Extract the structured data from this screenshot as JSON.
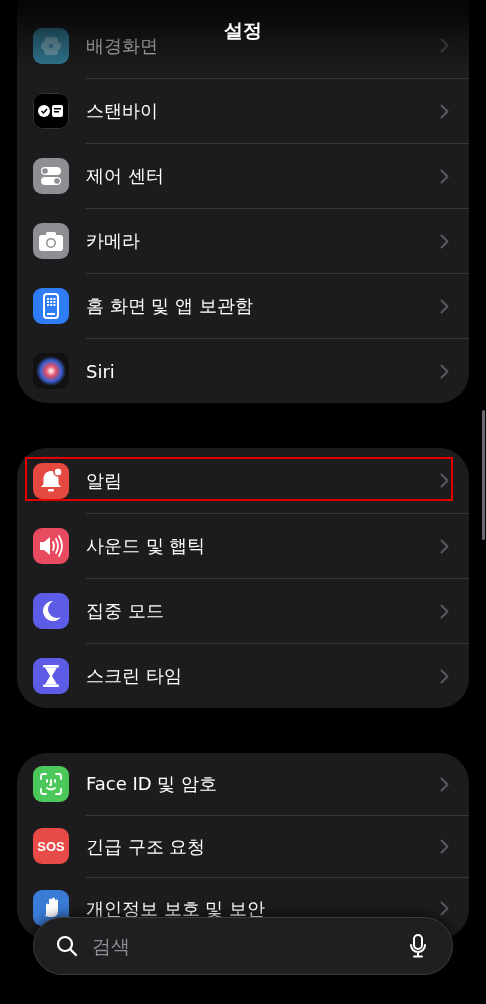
{
  "title": "설정",
  "groups": [
    {
      "items": [
        {
          "kind": "wallpaper",
          "label": "배경화면",
          "dimmed": true,
          "highlighted": false
        },
        {
          "kind": "standby",
          "label": "스탠바이",
          "dimmed": false,
          "highlighted": false
        },
        {
          "kind": "control",
          "label": "제어 센터",
          "dimmed": false,
          "highlighted": false
        },
        {
          "kind": "camera",
          "label": "카메라",
          "dimmed": false,
          "highlighted": false
        },
        {
          "kind": "home",
          "label": "홈 화면 및 앱 보관함",
          "dimmed": false,
          "highlighted": false
        },
        {
          "kind": "siri",
          "label": "Siri",
          "dimmed": false,
          "highlighted": false
        }
      ]
    },
    {
      "items": [
        {
          "kind": "bell",
          "label": "알림",
          "dimmed": false,
          "highlighted": true
        },
        {
          "kind": "sound",
          "label": "사운드 및 햅틱",
          "dimmed": false,
          "highlighted": false
        },
        {
          "kind": "moon",
          "label": "집중 모드",
          "dimmed": false,
          "highlighted": false
        },
        {
          "kind": "hourglass",
          "label": "스크린 타임",
          "dimmed": false,
          "highlighted": false
        }
      ]
    },
    {
      "items": [
        {
          "kind": "faceid",
          "label": "Face ID 및 암호",
          "dimmed": false,
          "highlighted": false
        },
        {
          "kind": "sos",
          "icon_text": "SOS",
          "label": "긴급 구조 요청",
          "dimmed": false,
          "highlighted": false
        },
        {
          "kind": "hand",
          "label": "개인정보 보호 및 보안",
          "dimmed": false,
          "highlighted": false
        }
      ]
    }
  ],
  "search": {
    "placeholder": "검색"
  }
}
